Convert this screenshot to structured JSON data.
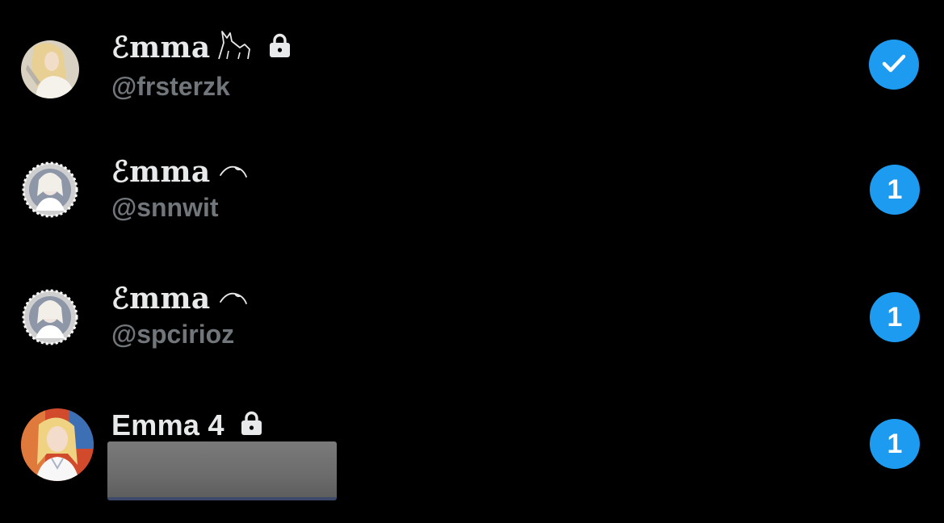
{
  "accounts": [
    {
      "display_name": "ℰmma",
      "decoration": "fox-emoji",
      "locked": true,
      "handle": "@frsterzk",
      "status": "selected",
      "badge_text": ""
    },
    {
      "display_name": "ℰmma",
      "decoration": "ribbon-swirl",
      "locked": false,
      "handle": "@snnwit",
      "status": "unread",
      "badge_text": "1"
    },
    {
      "display_name": "ℰmma",
      "decoration": "ribbon-swirl",
      "locked": false,
      "handle": "@spcirioz",
      "status": "unread",
      "badge_text": "1"
    },
    {
      "display_name": "Emma 4",
      "decoration": "",
      "locked": true,
      "handle": "",
      "handle_redacted": true,
      "status": "unread",
      "badge_text": "1"
    }
  ],
  "colors": {
    "background": "#000000",
    "display_name": "#e7e9ea",
    "handle": "#71767b",
    "badge": "#1d9bf0",
    "badge_text": "#ffffff"
  },
  "icons": {
    "lock": "lock-icon",
    "selected": "checkmark-icon"
  }
}
